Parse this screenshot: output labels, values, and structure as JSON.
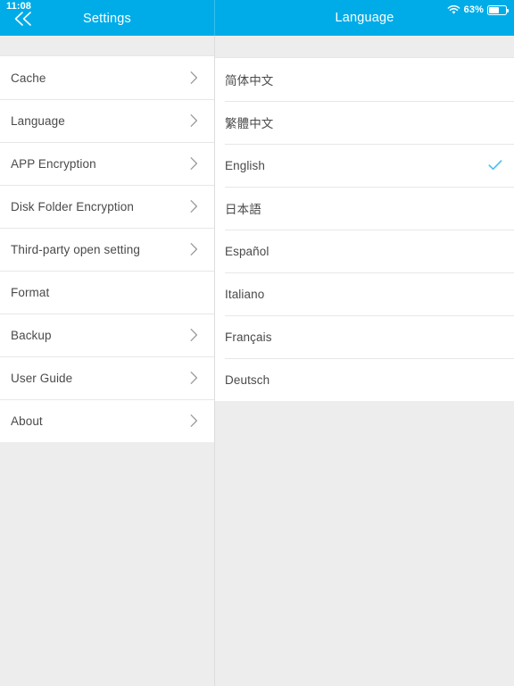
{
  "status_bar": {
    "time": "11:08",
    "wifi_icon": "wifi-icon",
    "battery_percent": "63%",
    "battery_level": 63,
    "battery_icon": "battery-icon"
  },
  "header": {
    "back_icon": "double-chevron-left-icon",
    "left_title": "Settings",
    "right_title": "Language",
    "background_color": "#00ace8",
    "text_color": "#ffffff"
  },
  "settings_panel": {
    "rows": [
      {
        "label": "Cache",
        "chevron": true
      },
      {
        "label": "Language",
        "chevron": true
      },
      {
        "label": "APP Encryption",
        "chevron": true
      },
      {
        "label": "Disk Folder Encryption",
        "chevron": true
      },
      {
        "label": "Third-party open setting",
        "chevron": true
      },
      {
        "label": "Format",
        "chevron": false
      },
      {
        "label": "Backup",
        "chevron": true
      },
      {
        "label": "User Guide",
        "chevron": true
      },
      {
        "label": "About",
        "chevron": true
      }
    ]
  },
  "language_panel": {
    "selected": "English",
    "check_color": "#4fc0f0",
    "rows": [
      {
        "label": "简体中文",
        "selected": false
      },
      {
        "label": "繁體中文",
        "selected": false
      },
      {
        "label": "English",
        "selected": true
      },
      {
        "label": "日本語",
        "selected": false
      },
      {
        "label": "Español",
        "selected": false
      },
      {
        "label": "Italiano",
        "selected": false
      },
      {
        "label": "Français",
        "selected": false
      },
      {
        "label": "Deutsch",
        "selected": false
      }
    ]
  },
  "colors": {
    "accent": "#00ace8",
    "page_background": "#ededed",
    "row_background": "#ffffff",
    "separator": "#e7e7e7",
    "label_text": "#4a4a4a",
    "chevron": "#9b9b9b"
  }
}
